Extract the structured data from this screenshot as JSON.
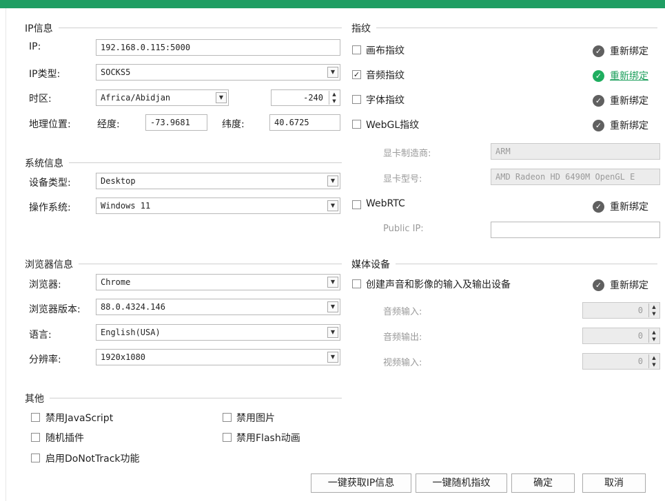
{
  "ip_section": {
    "title": "IP信息",
    "ip_label": "IP:",
    "ip_value": "192.168.0.115:5000",
    "type_label": "IP类型:",
    "type_value": "SOCKS5",
    "tz_label": "时区:",
    "tz_value": "Africa/Abidjan",
    "tz_offset": "-240",
    "geo_label": "地理位置:",
    "lon_label": "经度:",
    "lon_value": "-73.9681",
    "lat_label": "纬度:",
    "lat_value": "40.6725"
  },
  "system_section": {
    "title": "系统信息",
    "device_label": "设备类型:",
    "device_value": "Desktop",
    "os_label": "操作系统:",
    "os_value": "Windows 11"
  },
  "browser_section": {
    "title": "浏览器信息",
    "browser_label": "浏览器:",
    "browser_value": "Chrome",
    "version_label": "浏览器版本:",
    "version_value": "88.0.4324.146",
    "lang_label": "语言:",
    "lang_value": "English(USA)",
    "res_label": "分辨率:",
    "res_value": "1920x1080"
  },
  "other_section": {
    "title": "其他",
    "disable_js": "禁用JavaScript",
    "disable_images": "禁用图片",
    "random_plugins": "随机插件",
    "disable_flash": "禁用Flash动画",
    "enable_dnt": "启用DoNotTrack功能"
  },
  "fingerprint_section": {
    "title": "指纹",
    "canvas": "画布指纹",
    "audio": "音频指纹",
    "font": "字体指纹",
    "webgl": "WebGL指纹",
    "gpu_vendor_label": "显卡制造商:",
    "gpu_vendor_value": "ARM",
    "gpu_model_label": "显卡型号:",
    "gpu_model_value": "AMD Radeon HD 6490M OpenGL E",
    "webrtc": "WebRTC",
    "public_ip_label": "Public IP:",
    "public_ip_value": "",
    "rebind": "重新绑定",
    "check": "✓"
  },
  "media_section": {
    "title": "媒体设备",
    "create_devices": "创建声音和影像的输入及输出设备",
    "audio_in_label": "音频输入:",
    "audio_out_label": "音频输出:",
    "video_in_label": "视频输入:",
    "audio_in_value": "0",
    "audio_out_value": "0",
    "video_in_value": "0"
  },
  "footer": {
    "fetch_ip": "一键获取IP信息",
    "random_fp": "一键随机指纹",
    "ok": "确定",
    "cancel": "取消"
  },
  "colors": {
    "accent": "#1f9e63",
    "rebind_active": "#1a9e5a"
  },
  "icons": {
    "dropdown": "▼",
    "spin_up": "▲",
    "spin_down": "▼",
    "rebind": "check-circle-icon"
  }
}
